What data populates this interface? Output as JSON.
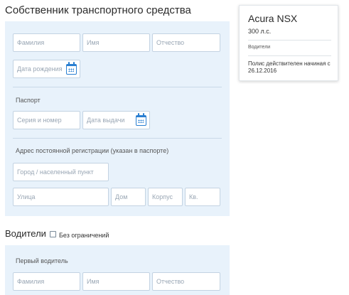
{
  "owner": {
    "title": "Собственник транспортного средства",
    "last_name_placeholder": "Фамилия",
    "first_name_placeholder": "Имя",
    "patronymic_placeholder": "Отчество",
    "birth_date_placeholder": "Дата рождения",
    "passport_label": "Паспорт",
    "passport_number_placeholder": "Серия и номер",
    "issue_date_placeholder": "Дата выдачи",
    "address_label": "Адрес постоянной регистрации (указан в паспорте)",
    "city_placeholder": "Город / населенный пункт",
    "street_placeholder": "Улица",
    "house_placeholder": "Дом",
    "building_placeholder": "Корпус",
    "apartment_placeholder": "Кв."
  },
  "drivers": {
    "title": "Водители",
    "unlimited_label": "Без ограничений",
    "first_driver_label": "Первый водитель",
    "last_name_placeholder": "Фамилия",
    "first_name_placeholder": "Имя",
    "patronymic_placeholder": "Отчество"
  },
  "summary": {
    "car_name": "Acura NSX",
    "power": "300 л.с.",
    "drivers_label": "Водители",
    "policy_text": "Полис действителен начиная с 26.12.2016"
  },
  "colors": {
    "panel_bg": "#e8f2fb",
    "field_border": "#c3d3e2",
    "accent": "#2a7fd1"
  },
  "icons": {
    "calendar": "calendar-icon"
  }
}
